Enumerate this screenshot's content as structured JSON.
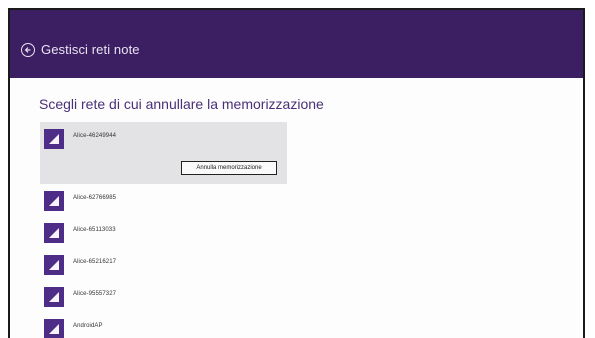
{
  "header": {
    "title": "Gestisci reti note",
    "back_icon": "back-arrow-circle-icon"
  },
  "section_title": "Scegli rete di cui annullare la memorizzazione",
  "networks": [
    {
      "name": "Alice-46249944",
      "icon": "wifi-signal-icon"
    },
    {
      "name": "Alice-62766985",
      "icon": "wifi-signal-icon"
    },
    {
      "name": "Alice-65113033",
      "icon": "wifi-signal-icon"
    },
    {
      "name": "Alice-65216217",
      "icon": "wifi-signal-icon"
    },
    {
      "name": "Alice-95557327",
      "icon": "wifi-signal-icon"
    },
    {
      "name": "AndroidAP",
      "icon": "wifi-signal-icon"
    }
  ],
  "forget_button": "Annulla memorizzazione",
  "colors": {
    "header": "#3c1e63",
    "tile": "#4e2d88",
    "selected": "#e3e3e6",
    "title": "#4a2f78"
  }
}
